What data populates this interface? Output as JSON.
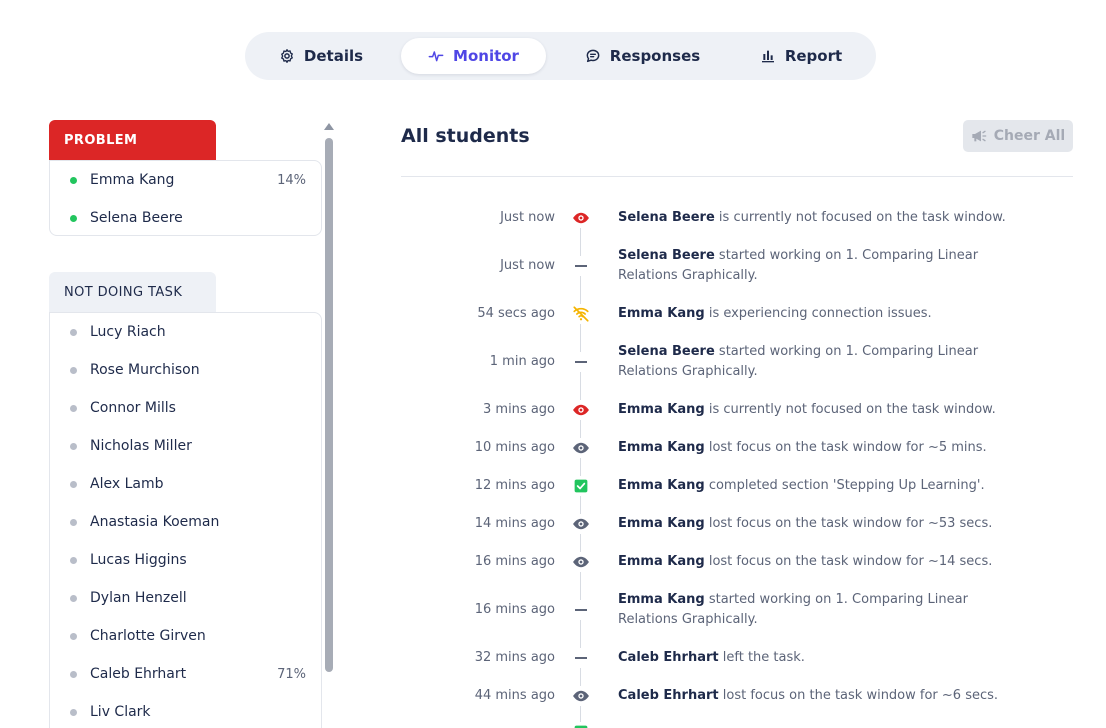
{
  "tabs": [
    {
      "label": "Details",
      "icon": "gear-icon",
      "active": false
    },
    {
      "label": "Monitor",
      "icon": "activity-icon",
      "active": true
    },
    {
      "label": "Responses",
      "icon": "chat-icon",
      "active": false
    },
    {
      "label": "Report",
      "icon": "bar-chart-icon",
      "active": false
    }
  ],
  "sidebar": {
    "problem": {
      "label": "PROBLEM",
      "students": [
        {
          "name": "Emma Kang",
          "pct": "14%"
        },
        {
          "name": "Selena Beere",
          "pct": ""
        }
      ]
    },
    "not_doing": {
      "label": "NOT DOING TASK",
      "students": [
        {
          "name": "Lucy Riach",
          "pct": ""
        },
        {
          "name": "Rose Murchison",
          "pct": ""
        },
        {
          "name": "Connor Mills",
          "pct": ""
        },
        {
          "name": "Nicholas Miller",
          "pct": ""
        },
        {
          "name": "Alex Lamb",
          "pct": ""
        },
        {
          "name": "Anastasia Koeman",
          "pct": ""
        },
        {
          "name": "Lucas Higgins",
          "pct": ""
        },
        {
          "name": "Dylan Henzell",
          "pct": ""
        },
        {
          "name": "Charlotte Girven",
          "pct": ""
        },
        {
          "name": "Caleb Ehrhart",
          "pct": "71%"
        },
        {
          "name": "Liv Clark",
          "pct": ""
        }
      ]
    }
  },
  "main": {
    "title": "All students",
    "cheer_label": "Cheer All",
    "events": [
      {
        "time": "Just now",
        "icon": "eye-alert-icon",
        "name": "Selena Beere",
        "text": "is currently not focused on the task window."
      },
      {
        "time": "Just now",
        "icon": "dash-icon",
        "name": "Selena Beere",
        "text": "started working on 1. Comparing Linear Relations Graphically."
      },
      {
        "time": "54 secs ago",
        "icon": "wifi-off-icon",
        "name": "Emma Kang",
        "text": "is experiencing connection issues."
      },
      {
        "time": "1 min ago",
        "icon": "dash-icon",
        "name": "Selena Beere",
        "text": "started working on 1. Comparing Linear Relations Graphically."
      },
      {
        "time": "3 mins ago",
        "icon": "eye-alert-icon",
        "name": "Emma Kang",
        "text": "is currently not focused on the task window."
      },
      {
        "time": "10 mins ago",
        "icon": "eye-icon",
        "name": "Emma Kang",
        "text": "lost focus on the task window for ~5 mins."
      },
      {
        "time": "12 mins ago",
        "icon": "check-box-icon",
        "name": "Emma Kang",
        "text": "completed section 'Stepping Up Learning'."
      },
      {
        "time": "14 mins ago",
        "icon": "eye-icon",
        "name": "Emma Kang",
        "text": "lost focus on the task window for ~53 secs."
      },
      {
        "time": "16 mins ago",
        "icon": "eye-icon",
        "name": "Emma Kang",
        "text": "lost focus on the task window for ~14 secs."
      },
      {
        "time": "16 mins ago",
        "icon": "dash-icon",
        "name": "Emma Kang",
        "text": "started working on 1. Comparing Linear Relations Graphically."
      },
      {
        "time": "32 mins ago",
        "icon": "dash-icon",
        "name": "Caleb Ehrhart",
        "text": "left the task."
      },
      {
        "time": "44 mins ago",
        "icon": "eye-icon",
        "name": "Caleb Ehrhart",
        "text": "lost focus on the task window for ~6 secs."
      }
    ]
  },
  "colors": {
    "accent": "#4f46e5",
    "problem": "#dc2626",
    "online": "#22c55e",
    "warning": "#f5b400",
    "success": "#22c55e"
  }
}
